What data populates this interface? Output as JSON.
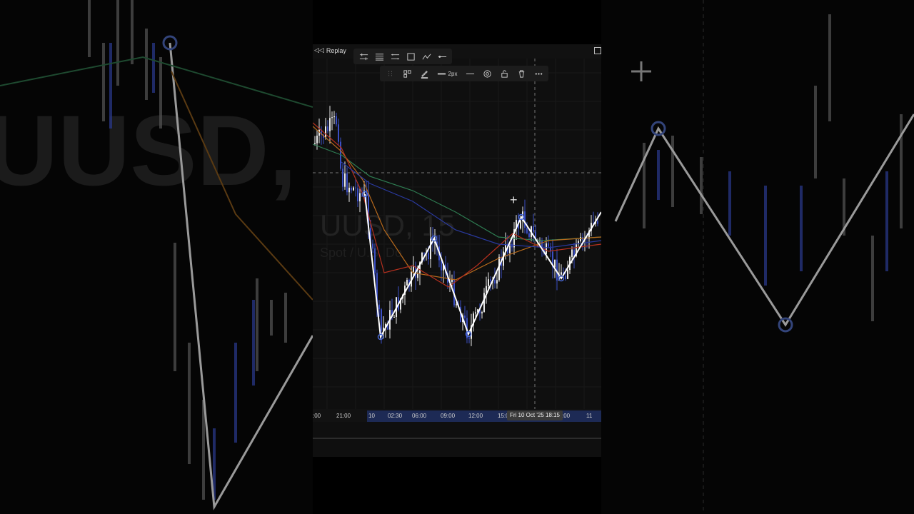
{
  "top_bar": {
    "replay_label": "Replay"
  },
  "toolbar_drawing": {
    "icons": [
      "trend-lines-icon",
      "fib-icon",
      "channel-icon",
      "rectangle-icon",
      "pattern-icon",
      "horizontal-line-icon"
    ]
  },
  "toolbar_style": {
    "stroke_width": "2px"
  },
  "watermark": {
    "symbol": "UUSD, 15",
    "description": "Spot / U.S. Do"
  },
  "time_axis": {
    "ticks": [
      ":00",
      "21:00",
      "10",
      "02:30",
      "06:00",
      "09:00",
      "12:00",
      "15:0",
      ":00",
      "11"
    ],
    "crosshair_label": "Fri 10 Oct '25   18:15"
  },
  "colors": {
    "bull": "#e8e8e8",
    "bear": "#3b4fc4",
    "zigzag": "#ffffff",
    "ema_red": "#b5301f",
    "ema_orange": "#b86a1c",
    "ema_green": "#2e7d52",
    "ema_blue": "#2a3aa0",
    "selection": "#1d2a55"
  }
}
